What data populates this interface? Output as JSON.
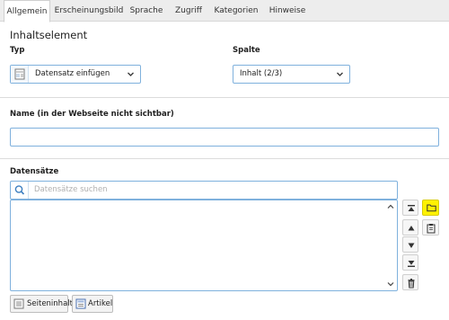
{
  "tabs": [
    {
      "label": "Allgemein",
      "active": true
    },
    {
      "label": "Erscheinungsbild",
      "active": false
    },
    {
      "label": "Sprache",
      "active": false
    },
    {
      "label": "Zugriff",
      "active": false
    },
    {
      "label": "Kategorien",
      "active": false
    },
    {
      "label": "Hinweise",
      "active": false
    }
  ],
  "content_element": {
    "title": "Inhaltselement",
    "type": {
      "label": "Typ",
      "value": "Datensatz einfügen",
      "icon": "record-icon"
    },
    "column": {
      "label": "Spalte",
      "value": "Inhalt (2/3)"
    }
  },
  "name": {
    "label": "Name (in der Webseite nicht sichtbar)",
    "value": ""
  },
  "records": {
    "label": "Datensätze",
    "search_placeholder": "Datensätze suchen",
    "items": [],
    "controls": [
      "move-top-icon",
      "move-up-icon",
      "move-down-icon",
      "move-bottom-icon",
      "delete-icon"
    ],
    "side_buttons": [
      "folder-icon",
      "clipboard-icon"
    ],
    "add_buttons": [
      {
        "label": "Seiteninhalt",
        "icon": "content-icon"
      },
      {
        "label": "Artikel",
        "icon": "article-icon"
      }
    ]
  },
  "colors": {
    "accent_border": "#7fb1dd",
    "folder_highlight": "#fff200"
  }
}
